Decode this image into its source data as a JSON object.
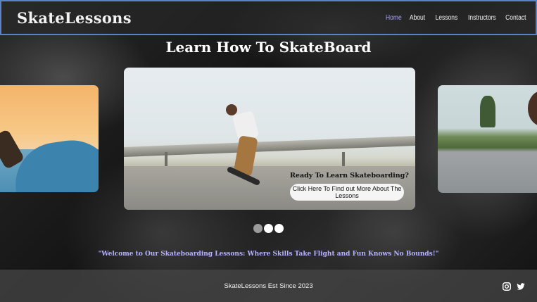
{
  "header": {
    "logo": "SkateLessons",
    "nav": [
      {
        "label": "Home",
        "active": true
      },
      {
        "label": "About",
        "active": false
      },
      {
        "label": "Lessons",
        "active": false
      },
      {
        "label": "Instructors",
        "active": false
      },
      {
        "label": "Contact",
        "active": false
      }
    ]
  },
  "hero": {
    "title": "Learn How To SkateBoard",
    "cta_text": "Ready To Learn Skateboarding?",
    "cta_button": "Click Here To Find out More About The Lessons"
  },
  "carousel": {
    "slides": 3,
    "active_index": 0
  },
  "tagline": "\"Welcome to Our Skateboarding Lessons: Where Skills Take Flight and Fun Knows No Bounds!\"",
  "footer": {
    "text": "SkateLessons Est Since 2023",
    "social_icons": [
      "instagram-icon",
      "twitter-icon"
    ]
  },
  "colors": {
    "header_border": "#5a82c8",
    "nav_active": "#a9a1ff",
    "tagline": "#b9b2ff"
  }
}
